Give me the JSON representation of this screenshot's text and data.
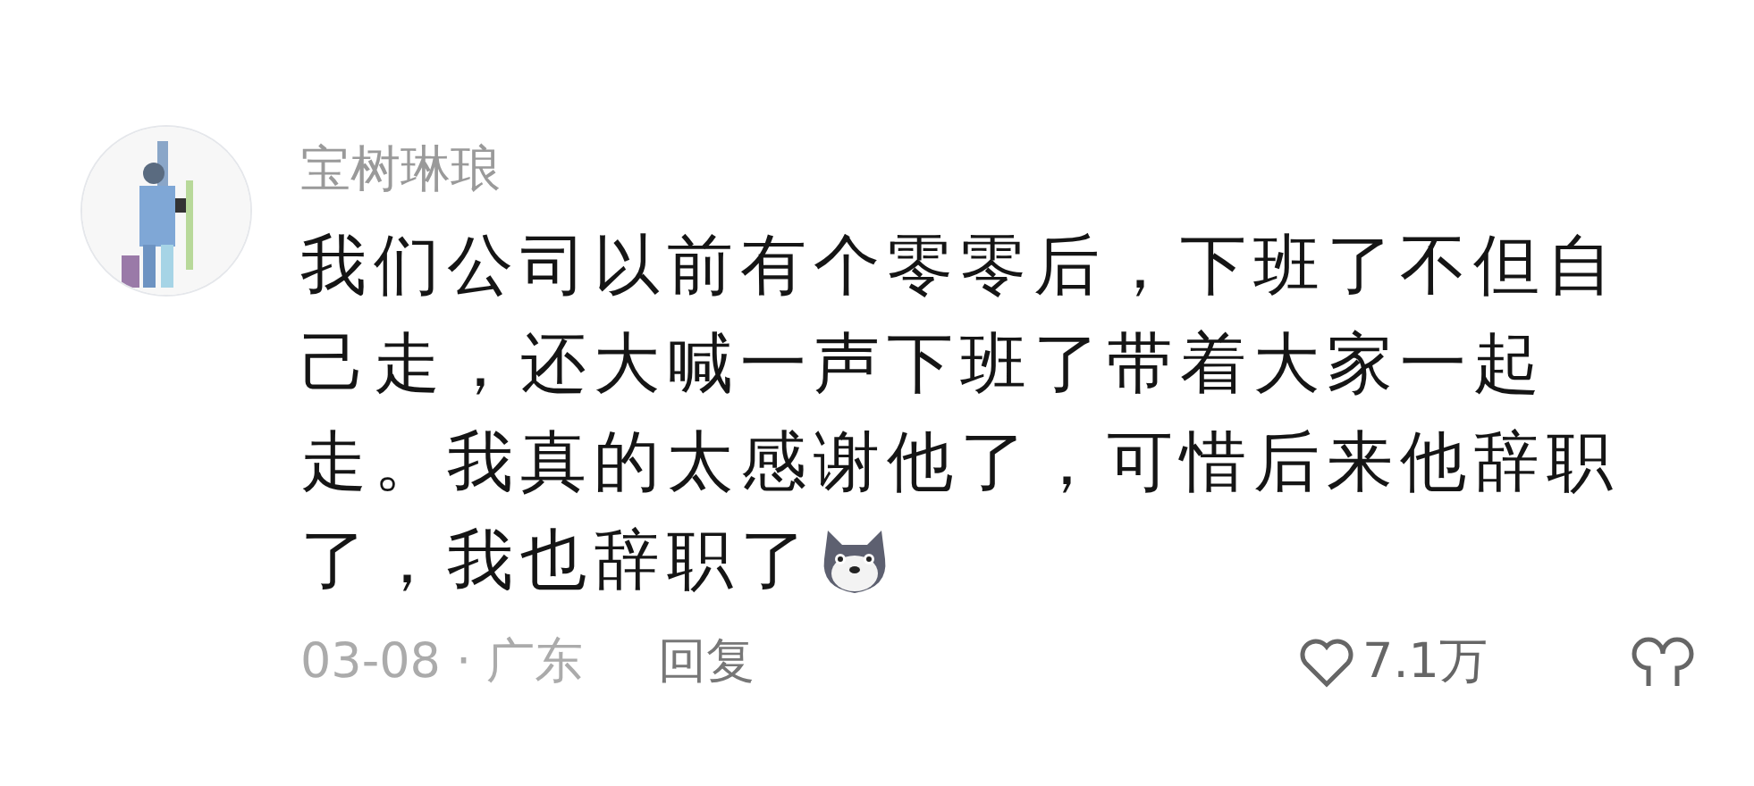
{
  "comment": {
    "author": "宝树琳琅",
    "text_lines": [
      "我们公司以前有个零零后，下班了不但自",
      "己走，还大喊一声下班了带着大家一起",
      "走。我真的太感谢他了，可惜后来他辞职",
      "了，我也辞职了"
    ],
    "date_location": "03-08 · 广东",
    "reply_label": "回复",
    "likes": "7.1万"
  }
}
